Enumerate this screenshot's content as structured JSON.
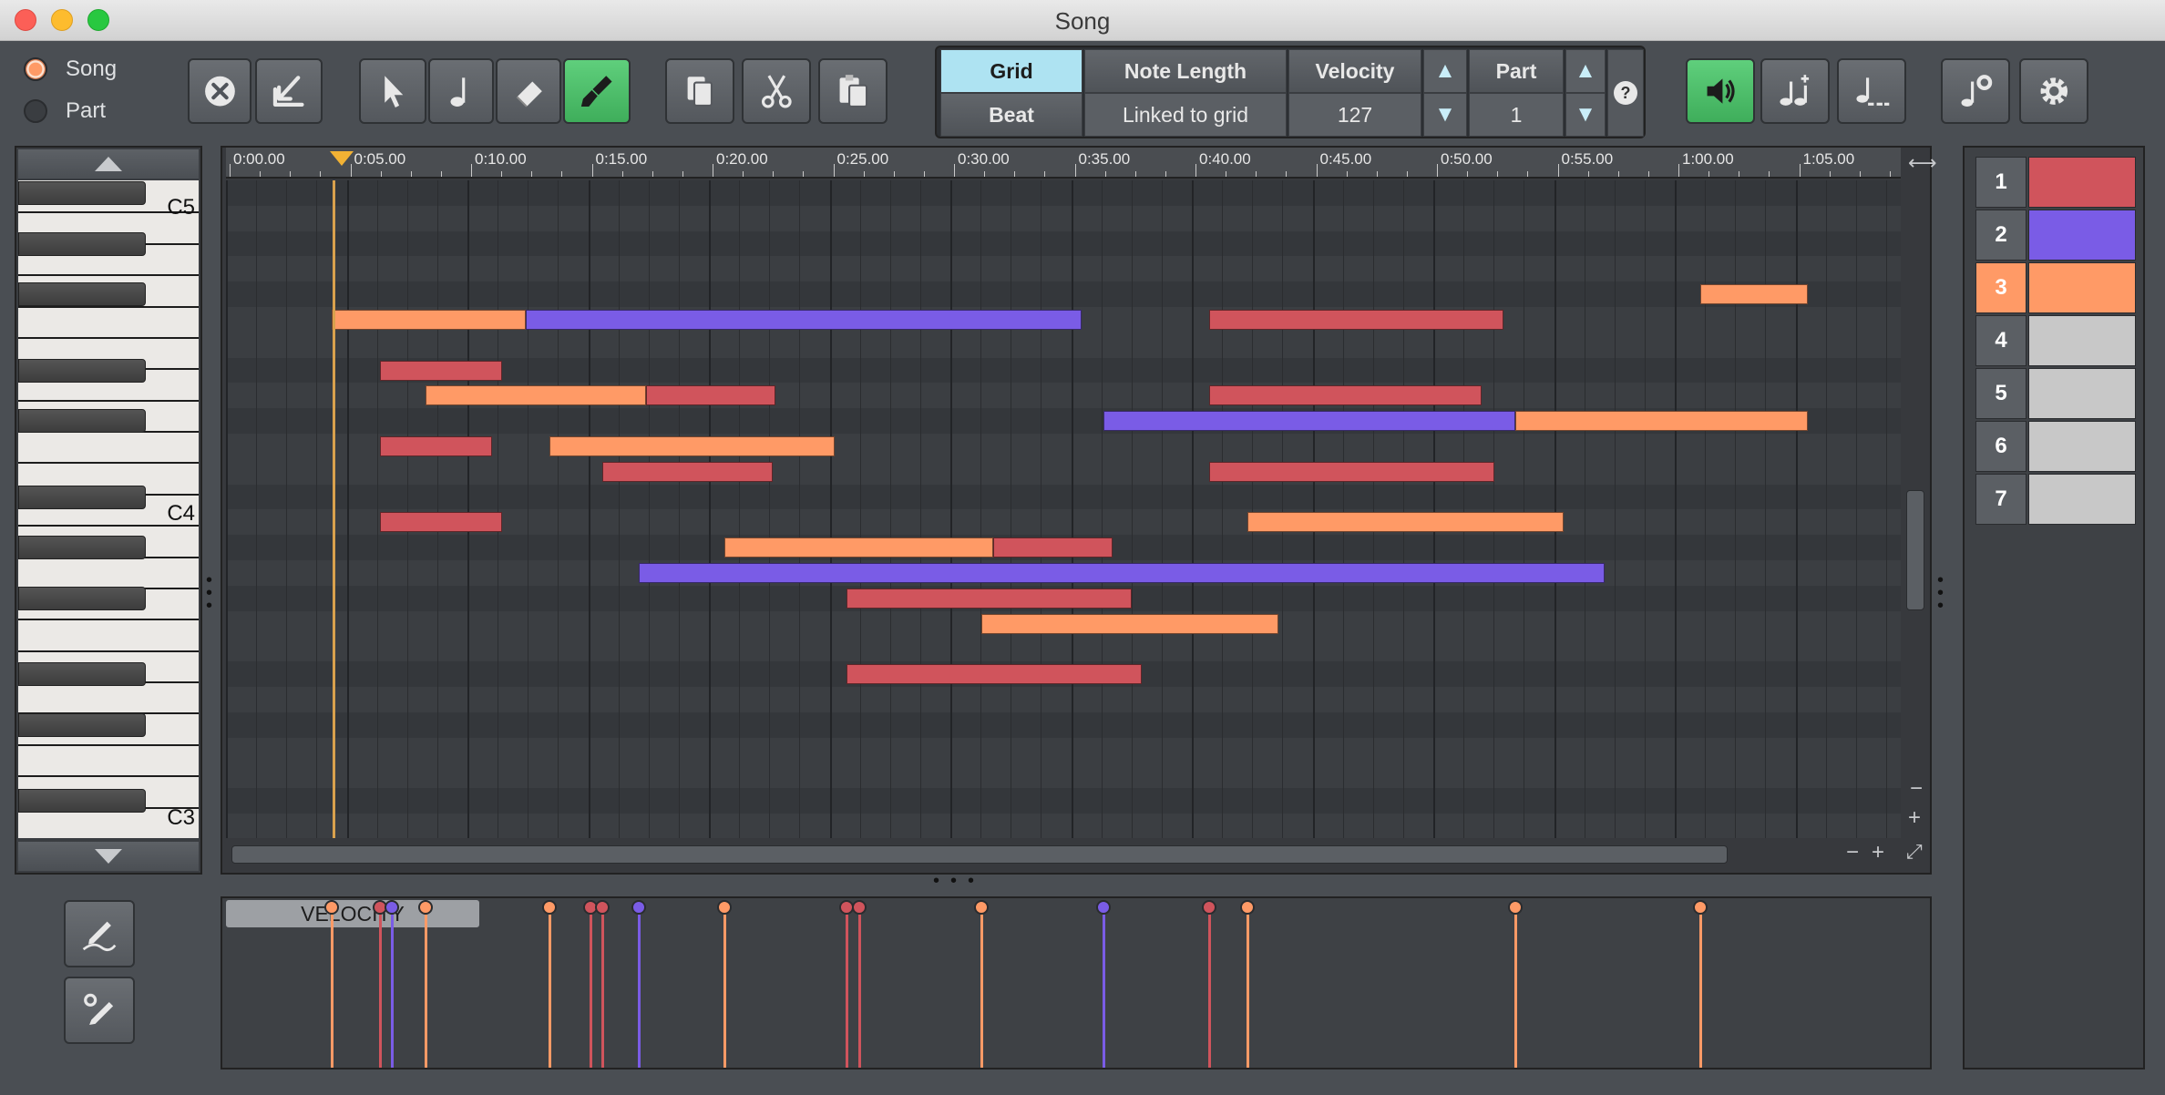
{
  "window": {
    "title": "Song"
  },
  "mode": {
    "song_label": "Song",
    "part_label": "Part",
    "selected": "Song"
  },
  "toolbar": {
    "grid_header": "Grid",
    "grid_value": "Beat",
    "note_length_header": "Note Length",
    "note_length_value": "Linked to grid",
    "velocity_header": "Velocity",
    "velocity_value": "127",
    "part_header": "Part",
    "part_value": "1",
    "up_arrow": "▲",
    "down_arrow": "▼",
    "help": "?"
  },
  "ruler": {
    "labels": [
      "0:00.00",
      "0:05.00",
      "0:10.00",
      "0:15.00",
      "0:20.00",
      "0:25.00",
      "0:30.00",
      "0:35.00",
      "0:40.00",
      "0:45.00",
      "0:50.00",
      "0:55.00",
      "1:00.00",
      "1:05.00"
    ]
  },
  "piano": {
    "labels": [
      "C5",
      "C4",
      "C3"
    ]
  },
  "velocity_lane": {
    "label": "VELOCITY"
  },
  "parts": [
    {
      "num": "1",
      "color": "#d0545c"
    },
    {
      "num": "2",
      "color": "#7a5ce6"
    },
    {
      "num": "3",
      "color": "#ff9a66"
    },
    {
      "num": "4",
      "color": "#c8c8c8"
    },
    {
      "num": "5",
      "color": "#c8c8c8"
    },
    {
      "num": "6",
      "color": "#c8c8c8"
    },
    {
      "num": "7",
      "color": "#c8c8c8"
    }
  ],
  "selected_part": "3",
  "colors": {
    "part1": "#d0545c",
    "part2": "#7a5ce6",
    "part3": "#ff9a66",
    "accent_green": "#4cc46a",
    "grid_selected": "#aee3f2"
  },
  "notes": [
    {
      "part": 3,
      "start": 0.0,
      "end": 0.81,
      "pitch_row": 5
    },
    {
      "part": 2,
      "start": 0.81,
      "end": 3.13,
      "pitch_row": 5
    },
    {
      "part": 1,
      "start": 0.2,
      "end": 0.71,
      "pitch_row": 7
    },
    {
      "part": 3,
      "start": 0.39,
      "end": 1.31,
      "pitch_row": 8
    },
    {
      "part": 1,
      "start": 1.31,
      "end": 1.85,
      "pitch_row": 8
    },
    {
      "part": 1,
      "start": 0.2,
      "end": 0.67,
      "pitch_row": 10
    },
    {
      "part": 3,
      "start": 0.91,
      "end": 2.1,
      "pitch_row": 10
    },
    {
      "part": 1,
      "start": 1.13,
      "end": 1.84,
      "pitch_row": 11
    },
    {
      "part": 1,
      "start": 0.2,
      "end": 0.71,
      "pitch_row": 13
    },
    {
      "part": 3,
      "start": 1.64,
      "end": 2.76,
      "pitch_row": 14
    },
    {
      "part": 1,
      "start": 2.76,
      "end": 3.26,
      "pitch_row": 14
    },
    {
      "part": 2,
      "start": 1.28,
      "end": 5.31,
      "pitch_row": 15
    },
    {
      "part": 1,
      "start": 2.15,
      "end": 3.34,
      "pitch_row": 16
    },
    {
      "part": 3,
      "start": 2.71,
      "end": 3.95,
      "pitch_row": 17
    },
    {
      "part": 1,
      "start": 2.15,
      "end": 3.38,
      "pitch_row": 19
    },
    {
      "part": 2,
      "start": 3.22,
      "end": 4.94,
      "pitch_row": 9
    },
    {
      "part": 3,
      "start": 4.94,
      "end": 6.16,
      "pitch_row": 9
    },
    {
      "part": 1,
      "start": 3.66,
      "end": 4.89,
      "pitch_row": 5
    },
    {
      "part": 1,
      "start": 3.66,
      "end": 4.8,
      "pitch_row": 8
    },
    {
      "part": 1,
      "start": 3.66,
      "end": 4.85,
      "pitch_row": 11
    },
    {
      "part": 3,
      "start": 3.82,
      "end": 5.14,
      "pitch_row": 13
    },
    {
      "part": 3,
      "start": 5.71,
      "end": 6.16,
      "pitch_row": 4
    }
  ],
  "velocity_points": [
    {
      "part": 3,
      "start": 0.0
    },
    {
      "part": 1,
      "start": 0.2
    },
    {
      "part": 2,
      "start": 0.25
    },
    {
      "part": 3,
      "start": 0.39
    },
    {
      "part": 3,
      "start": 0.91
    },
    {
      "part": 1,
      "start": 1.08
    },
    {
      "part": 1,
      "start": 1.13
    },
    {
      "part": 2,
      "start": 1.28
    },
    {
      "part": 3,
      "start": 1.64
    },
    {
      "part": 1,
      "start": 2.15
    },
    {
      "part": 1,
      "start": 2.2
    },
    {
      "part": 3,
      "start": 2.71
    },
    {
      "part": 2,
      "start": 3.22
    },
    {
      "part": 1,
      "start": 3.66
    },
    {
      "part": 3,
      "start": 3.82
    },
    {
      "part": 3,
      "start": 4.94
    },
    {
      "part": 3,
      "start": 5.71
    }
  ]
}
